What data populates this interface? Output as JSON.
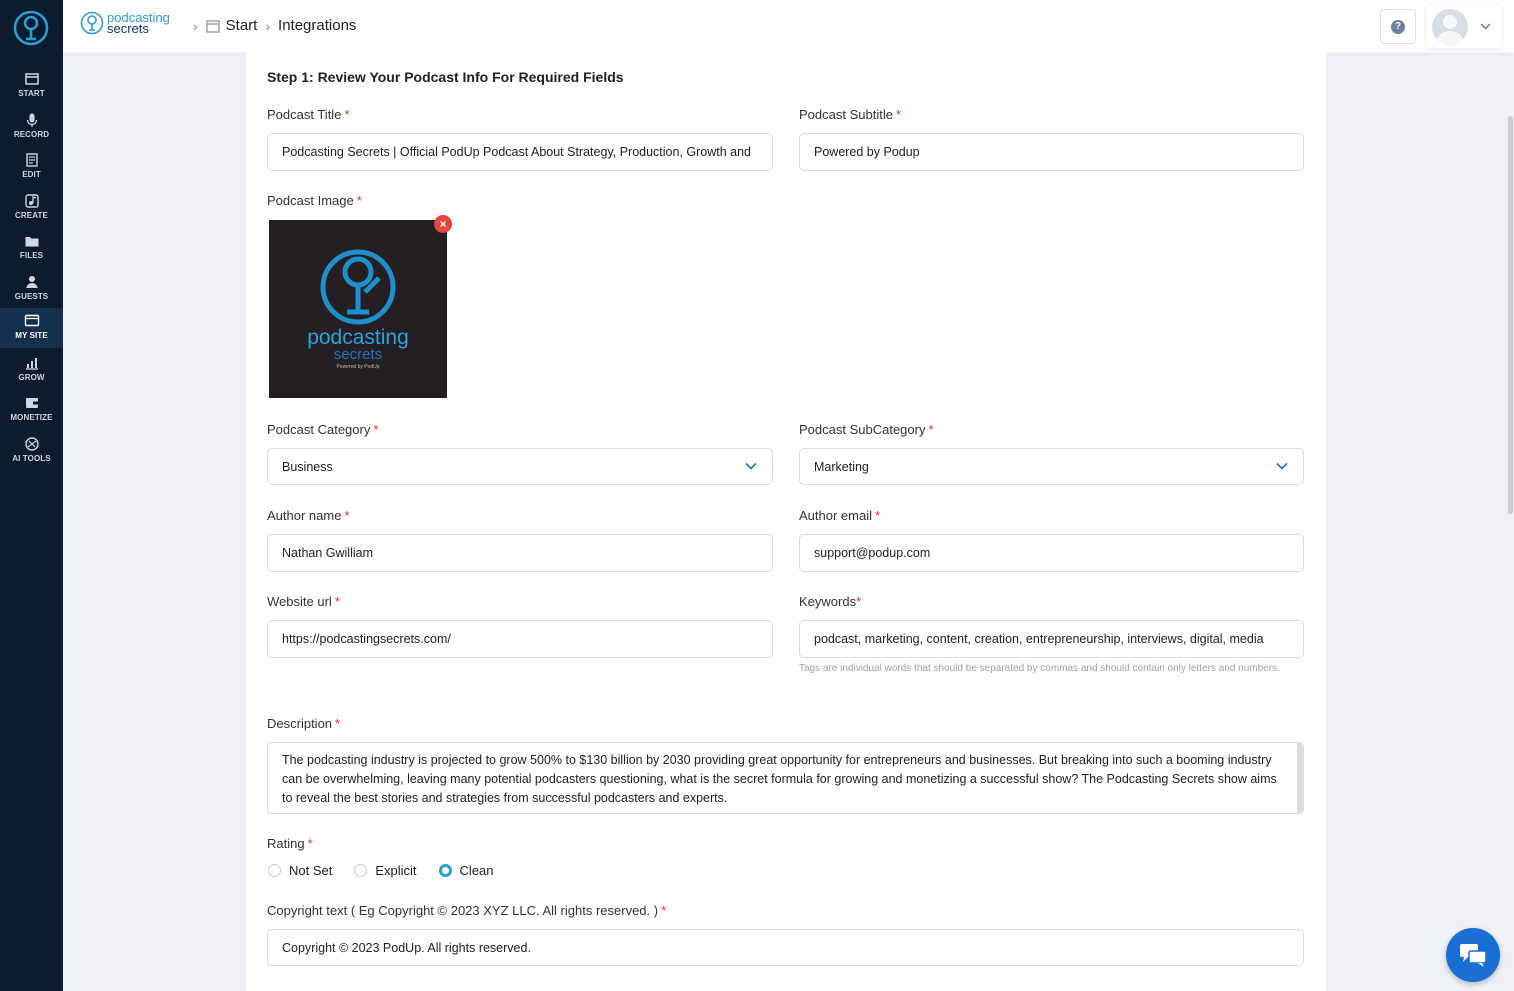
{
  "sidebar": {
    "items": [
      {
        "label": "START",
        "icon": "start-icon"
      },
      {
        "label": "RECORD",
        "icon": "microphone-icon"
      },
      {
        "label": "EDIT",
        "icon": "edit-icon"
      },
      {
        "label": "CREATE",
        "icon": "create-icon"
      },
      {
        "label": "FILES",
        "icon": "folder-icon"
      },
      {
        "label": "GUESTS",
        "icon": "guests-icon"
      },
      {
        "label": "MY SITE",
        "icon": "site-icon"
      },
      {
        "label": "GROW",
        "icon": "chart-icon"
      },
      {
        "label": "MONETIZE",
        "icon": "monetize-icon"
      },
      {
        "label": "AI TOOLS",
        "icon": "ai-icon"
      }
    ],
    "active": "MY SITE"
  },
  "header": {
    "brand_line1": "podcasting",
    "brand_line2": "secrets",
    "breadcrumb": [
      "Start",
      "Integrations"
    ],
    "help_label": "?"
  },
  "form": {
    "step_title": "Step 1: Review Your Podcast Info For Required Fields",
    "required_mark": "*",
    "title_label": "Podcast Title",
    "title_value": "Podcasting Secrets | Official PodUp Podcast About Strategy, Production, Growth and",
    "subtitle_label": "Podcast Subtitle",
    "subtitle_value": "Powered by Podup",
    "image_label": "Podcast Image",
    "image_text_line1": "podcasting",
    "image_text_line2": "secrets",
    "image_text_line3": "Powered by PodUp",
    "remove_label": "×",
    "category_label": "Podcast Category",
    "category_value": "Business",
    "subcategory_label": "Podcast SubCategory",
    "subcategory_value": "Marketing",
    "author_name_label": "Author name",
    "author_name_value": "Nathan Gwilliam",
    "author_email_label": "Author email",
    "author_email_value": "support@podup.com",
    "website_label": "Website url",
    "website_value": "https://podcastingsecrets.com/",
    "keywords_label": "Keywords",
    "keywords_value": "podcast, marketing, content, creation, entrepreneurship, interviews, digital, media",
    "keywords_hint": "Tags are individual words that should be separated by commas and should contain only letters and numbers.",
    "description_label": "Description",
    "description_value": "The podcasting industry is projected to grow 500% to $130 billion by 2030 providing great opportunity for entrepreneurs and businesses. But breaking into such a booming industry can be overwhelming, leaving many potential podcasters questioning, what is the secret formula for growing and monetizing a successful show? The Podcasting Secrets show aims to reveal the best stories and strategies from successful podcasters and experts.",
    "rating_label": "Rating",
    "rating_options": [
      "Not Set",
      "Explicit",
      "Clean"
    ],
    "rating_selected": "Clean",
    "copyright_label": "Copyright text ( Eg Copyright © 2023 XYZ LLC. All rights reserved. )",
    "copyright_value": "Copyright © 2023 PodUp. All rights reserved."
  },
  "colors": {
    "sidebar_bg": "#0c1b2e",
    "accent": "#2a9fd6",
    "required": "#e0332e",
    "chat": "#1a6fd6"
  }
}
